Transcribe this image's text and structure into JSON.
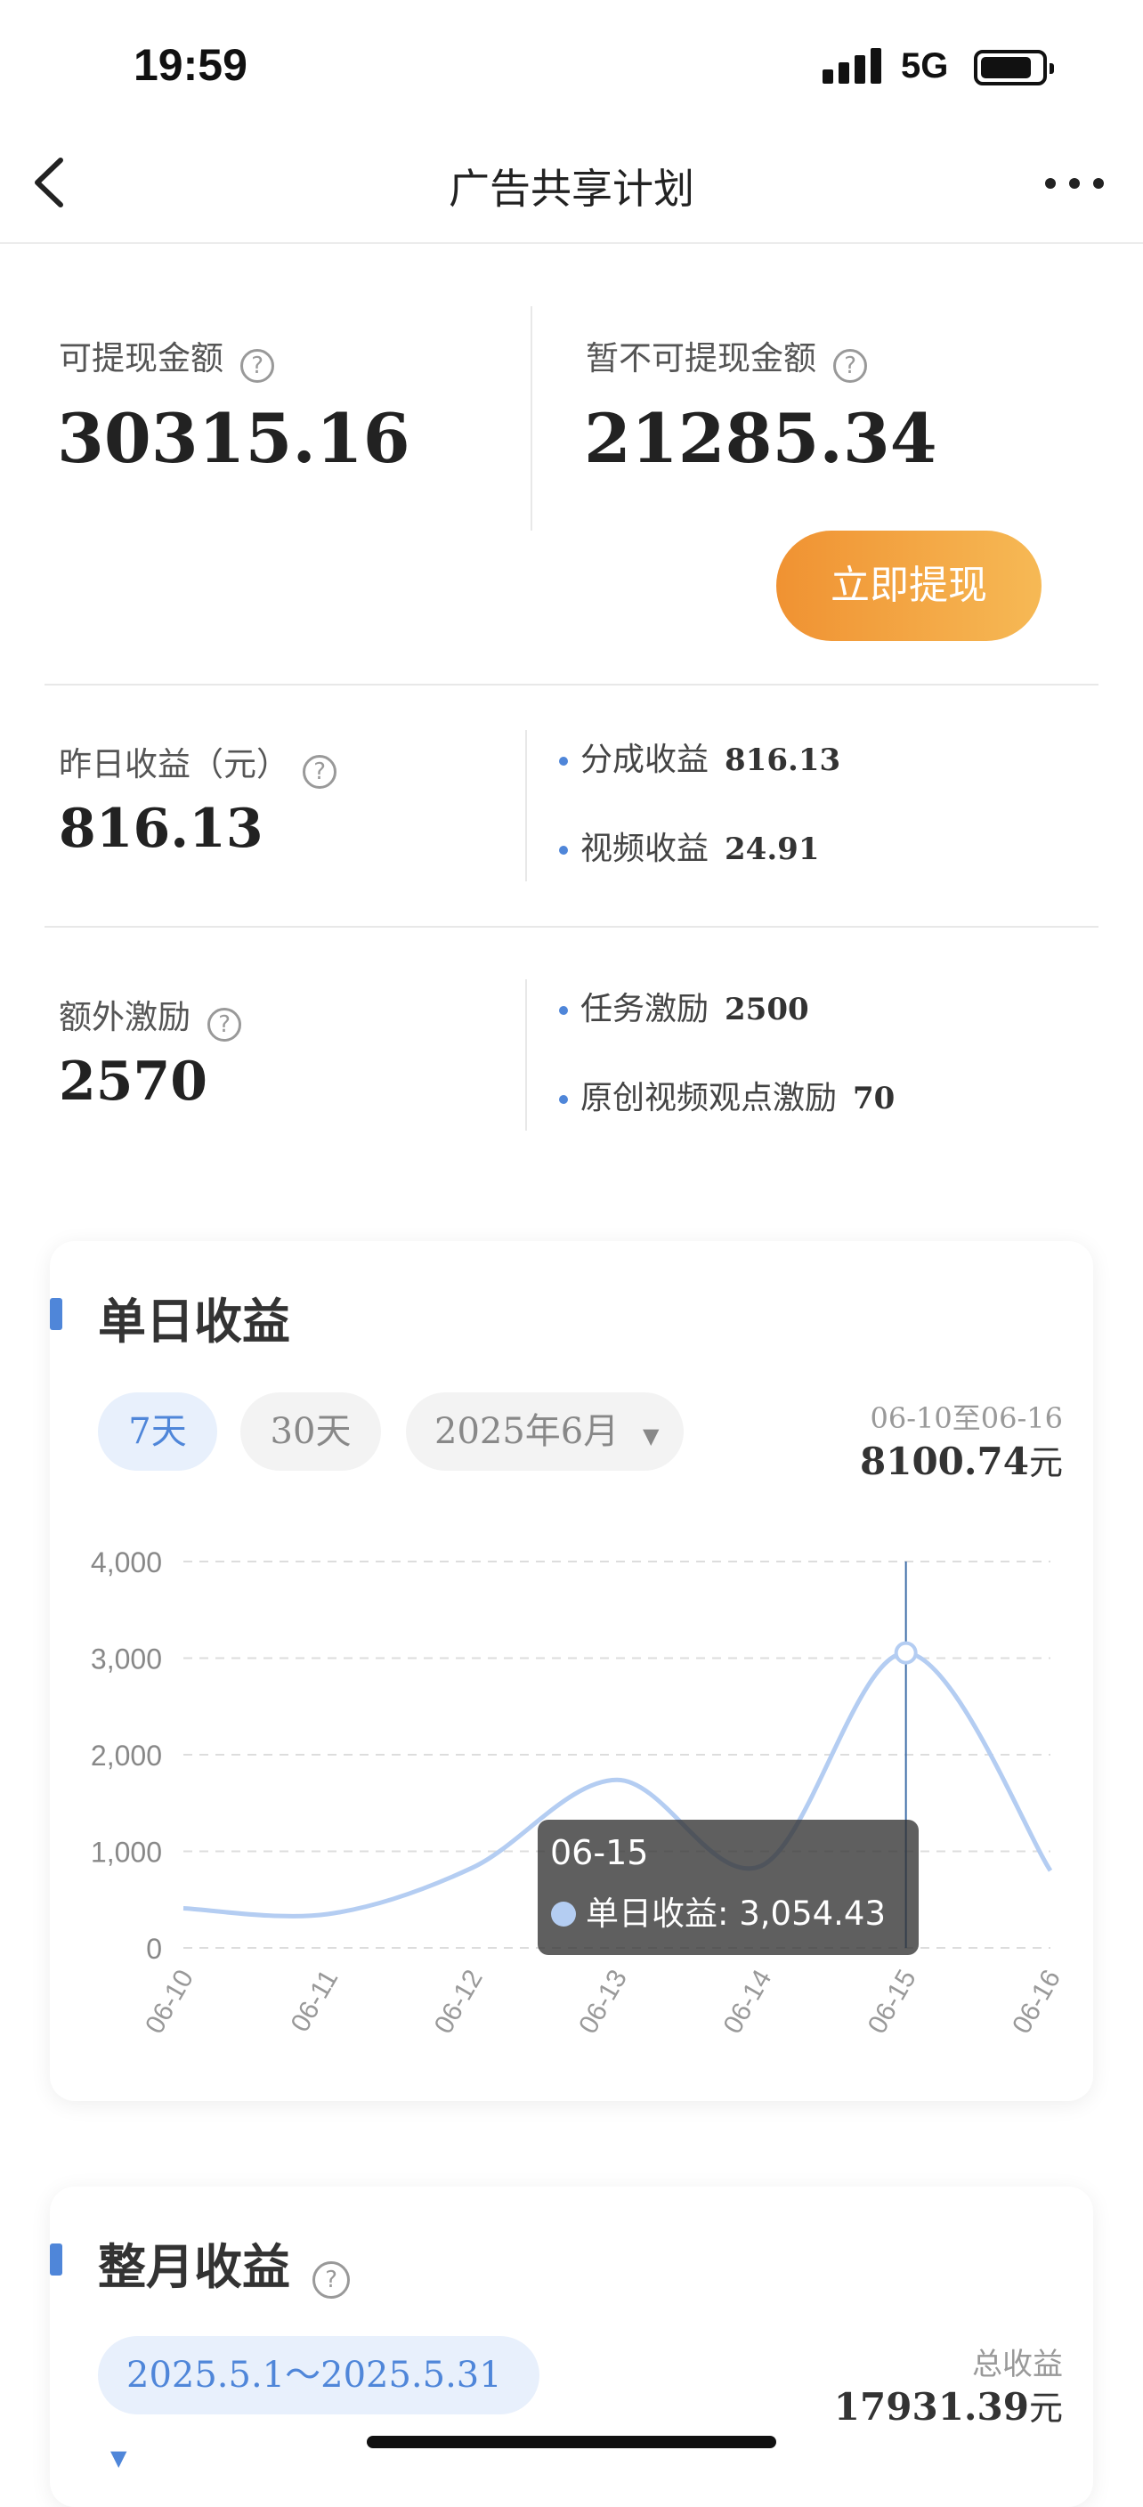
{
  "status": {
    "time": "19:59",
    "network": "5G"
  },
  "nav": {
    "title": "广告共享计划"
  },
  "balance": {
    "available_label": "可提现金额",
    "available_value": "30315.16",
    "unavailable_label": "暂不可提现金额",
    "unavailable_value": "21285.34",
    "withdraw_button": "立即提现"
  },
  "yesterday": {
    "label": "昨日收益（元）",
    "value": "816.13",
    "items": [
      {
        "label": "分成收益",
        "value": "816.13"
      },
      {
        "label": "视频收益",
        "value": "24.91"
      }
    ]
  },
  "extra": {
    "label": "额外激励",
    "value": "2570",
    "items": [
      {
        "label": "任务激励",
        "value": "2500"
      },
      {
        "label": "原创视频观点激励",
        "value": "70"
      }
    ]
  },
  "daily": {
    "title": "单日收益",
    "filters": {
      "seven": "7天",
      "thirty": "30天",
      "month": "2025年6月"
    },
    "range": "06-10至06-16",
    "total": "8100.74",
    "unit": "元",
    "tooltip": {
      "date": "06-15",
      "label": "单日收益: 3,054.43"
    }
  },
  "chart_data": {
    "type": "line",
    "title": "单日收益",
    "categories": [
      "06-10",
      "06-11",
      "06-12",
      "06-13",
      "06-14",
      "06-15",
      "06-16"
    ],
    "series": [
      {
        "name": "单日收益",
        "values": [
          410,
          350,
          830,
          1740,
          850,
          3054.43,
          800
        ]
      }
    ],
    "yticks": [
      "4,000",
      "3,000",
      "2,000",
      "1,000",
      "0"
    ],
    "ylim": [
      0,
      4000
    ],
    "grid": true,
    "colors": {
      "line": "#b4cdf2",
      "grid": "#dddddd"
    }
  },
  "monthly": {
    "title": "整月收益",
    "period": "2025.5.1～2025.5.31",
    "total_label": "总收益",
    "total": "17931.39",
    "unit": "元"
  }
}
